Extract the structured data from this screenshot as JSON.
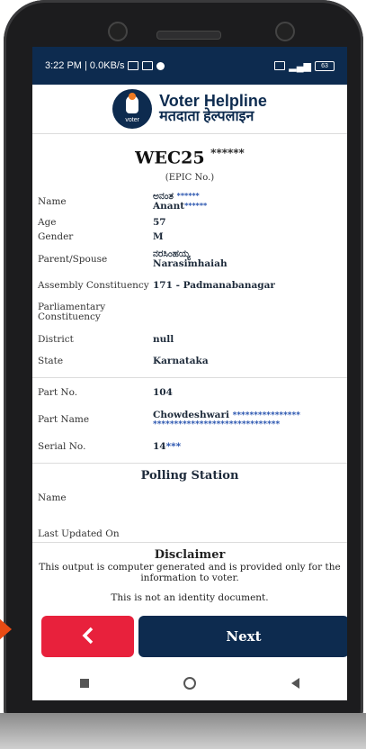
{
  "status_bar": {
    "time": "3:22 PM | 0.0KB/s",
    "battery": "63"
  },
  "app": {
    "logo_text": "voter",
    "title_en": "Voter Helpline",
    "title_hi": "मतदाता हेल्पलाइन"
  },
  "epic": {
    "number": "WEC25",
    "masked": "******",
    "label": "(EPIC No.)"
  },
  "details": {
    "name": {
      "label": "Name",
      "value_kn": "ಅನಂತ",
      "value_kn_mask": "******",
      "value_en": "Anant",
      "value_en_mask": "******"
    },
    "age": {
      "label": "Age",
      "value": "57"
    },
    "gender": {
      "label": "Gender",
      "value": "M"
    },
    "parent": {
      "label": "Parent/Spouse",
      "value_kn": "ನರಸಿಂಹಯ್ಯ",
      "value_en": "Narasimhaiah"
    },
    "assembly": {
      "label": "Assembly Constituency",
      "value": "171 - Padmanabanagar"
    },
    "parliamentary": {
      "label": "Parliamentary Constituency",
      "value": ""
    },
    "district": {
      "label": "District",
      "value": "null"
    },
    "state": {
      "label": "State",
      "value": "Karnataka"
    },
    "part_no": {
      "label": "Part No.",
      "value": "104"
    },
    "part_name": {
      "label": "Part Name",
      "value": "Chowdeshwari",
      "mask1": "****************",
      "mask2": "******************************"
    },
    "serial": {
      "label": "Serial No.",
      "value": "14",
      "mask": "***"
    }
  },
  "polling": {
    "title": "Polling Station",
    "name_label": "Name",
    "updated_label": "Last Updated On"
  },
  "disclaimer": {
    "title": "Disclaimer",
    "line1": "This output is computer generated and is provided only for the information to voter.",
    "line2": "This is not an identity document."
  },
  "buttons": {
    "back_icon": "chevron-left-icon",
    "next_label": "Next"
  },
  "colors": {
    "navy": "#0d2b4f",
    "red": "#e8213c",
    "highlight": "#1746a8",
    "arrow": "#e84b14"
  }
}
